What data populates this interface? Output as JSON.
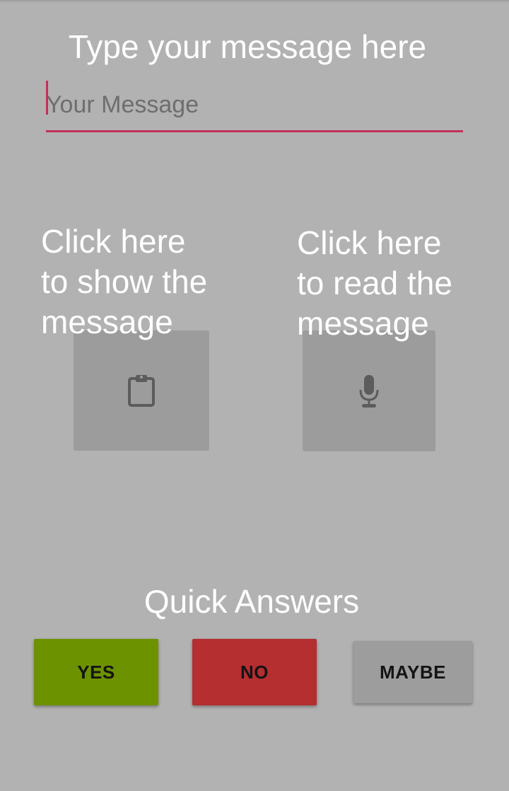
{
  "header": {
    "title": "Type your message here"
  },
  "message_input": {
    "placeholder": "Your Message",
    "value": ""
  },
  "show_action": {
    "caption": "Click here\nto show the\nmessage",
    "icon": "clipboard-icon"
  },
  "read_action": {
    "caption": "Click here\nto read the\nmessage",
    "icon": "microphone-icon"
  },
  "quick_answers": {
    "title": "Quick Answers",
    "buttons": [
      {
        "label": "YES",
        "color": "#6d9200"
      },
      {
        "label": "NO",
        "color": "#b52e30"
      },
      {
        "label": "MAYBE",
        "color": "#9d9d9d"
      }
    ]
  },
  "colors": {
    "background": "#b2b2b2",
    "accent": "#c2305a",
    "action_button": "#9c9c9c",
    "icon": "#5c5c5c"
  }
}
